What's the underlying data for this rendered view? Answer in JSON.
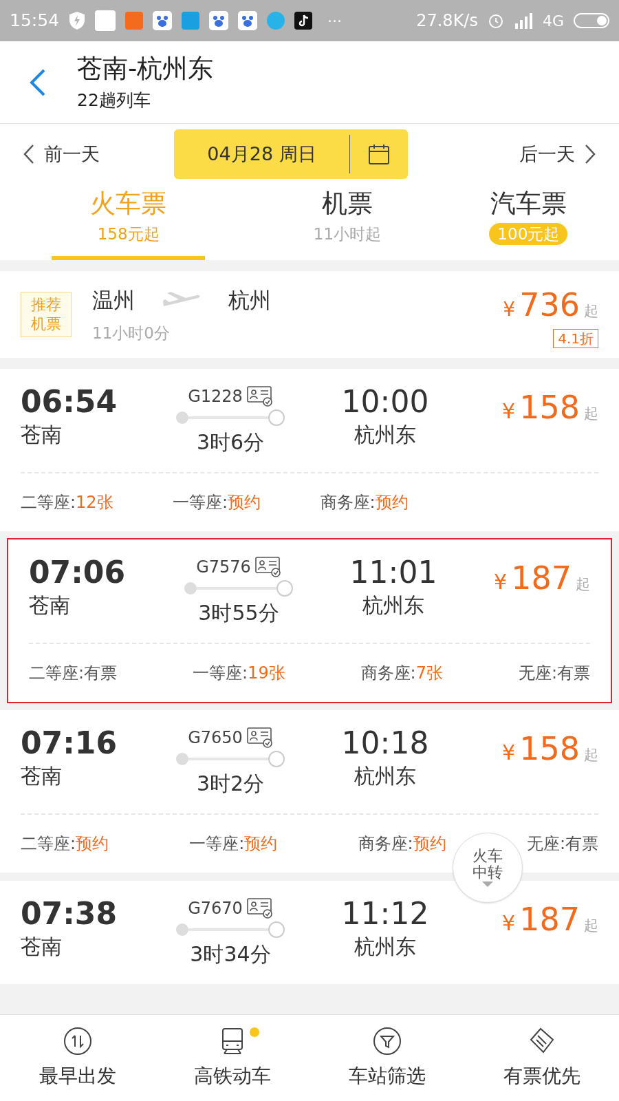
{
  "status_bar": {
    "time": "15:54",
    "apps": [
      {
        "kind": "shield"
      },
      {
        "kind": "mi"
      },
      {
        "kind": "tao",
        "color": "#f36b1c"
      },
      {
        "kind": "paw",
        "color": "#ffffff"
      },
      {
        "kind": "pay",
        "color": "#1a9fe0"
      },
      {
        "kind": "paw",
        "color": "#ffffff"
      },
      {
        "kind": "paw",
        "color": "#ffffff"
      },
      {
        "kind": "ball",
        "color": "#27b3e8"
      },
      {
        "kind": "note",
        "color": "#111111"
      }
    ],
    "more": "···",
    "speed": "27.8K/s",
    "network": "4G"
  },
  "header": {
    "title": "苍南-杭州东",
    "subtitle": "22趟列车"
  },
  "date_bar": {
    "prev": "前一天",
    "date": "04月28 周日",
    "next": "后一天"
  },
  "tabs": [
    {
      "label": "火车票",
      "sub": "158元起",
      "selected": true,
      "badge": false
    },
    {
      "label": "机票",
      "sub": "11小时起",
      "selected": false,
      "badge": false
    },
    {
      "label": "汽车票",
      "sub": "100元起",
      "selected": false,
      "badge": true
    }
  ],
  "flight": {
    "tag": "推荐机票",
    "from": "温州",
    "to": "杭州",
    "duration": "11小时0分",
    "currency": "¥",
    "price": "736",
    "suffix": "起",
    "discount": "4.1折"
  },
  "trains": [
    {
      "depart": "06:54",
      "from": "苍南",
      "number": "G1228",
      "duration": "3时6分",
      "arrive": "10:00",
      "to": "杭州东",
      "currency": "¥",
      "price": "158",
      "suffix": "起",
      "highlighted": false,
      "seats": [
        {
          "name": "二等座:",
          "value": "12张",
          "orange": true
        },
        {
          "name": "一等座:",
          "value": "预约",
          "orange": true
        },
        {
          "name": "商务座:",
          "value": "预约",
          "orange": true
        }
      ]
    },
    {
      "depart": "07:06",
      "from": "苍南",
      "number": "G7576",
      "duration": "3时55分",
      "arrive": "11:01",
      "to": "杭州东",
      "currency": "¥",
      "price": "187",
      "suffix": "起",
      "highlighted": true,
      "seats": [
        {
          "name": "二等座:",
          "value": "有票",
          "orange": false
        },
        {
          "name": "一等座:",
          "value": "19张",
          "orange": true
        },
        {
          "name": "商务座:",
          "value": "7张",
          "orange": true
        },
        {
          "name": "无座:",
          "value": "有票",
          "orange": false
        }
      ]
    },
    {
      "depart": "07:16",
      "from": "苍南",
      "number": "G7650",
      "duration": "3时2分",
      "arrive": "10:18",
      "to": "杭州东",
      "currency": "¥",
      "price": "158",
      "suffix": "起",
      "highlighted": false,
      "seats": [
        {
          "name": "二等座:",
          "value": "预约",
          "orange": true
        },
        {
          "name": "一等座:",
          "value": "预约",
          "orange": true
        },
        {
          "name": "商务座:",
          "value": "预约",
          "orange": true
        },
        {
          "name": "无座:",
          "value": "有票",
          "orange": false
        }
      ]
    },
    {
      "depart": "07:38",
      "from": "苍南",
      "number": "G7670",
      "duration": "3时34分",
      "arrive": "11:12",
      "to": "杭州东",
      "currency": "¥",
      "price": "187",
      "suffix": "起",
      "highlighted": false
    }
  ],
  "transfer_button": {
    "label": "火车中转"
  },
  "bottom_nav": [
    {
      "label": "最早出发",
      "kind": "sort",
      "dot": false
    },
    {
      "label": "高铁动车",
      "kind": "train",
      "dot": true
    },
    {
      "label": "车站筛选",
      "kind": "filter",
      "dot": false
    },
    {
      "label": "有票优先",
      "kind": "ticket",
      "dot": false
    }
  ]
}
